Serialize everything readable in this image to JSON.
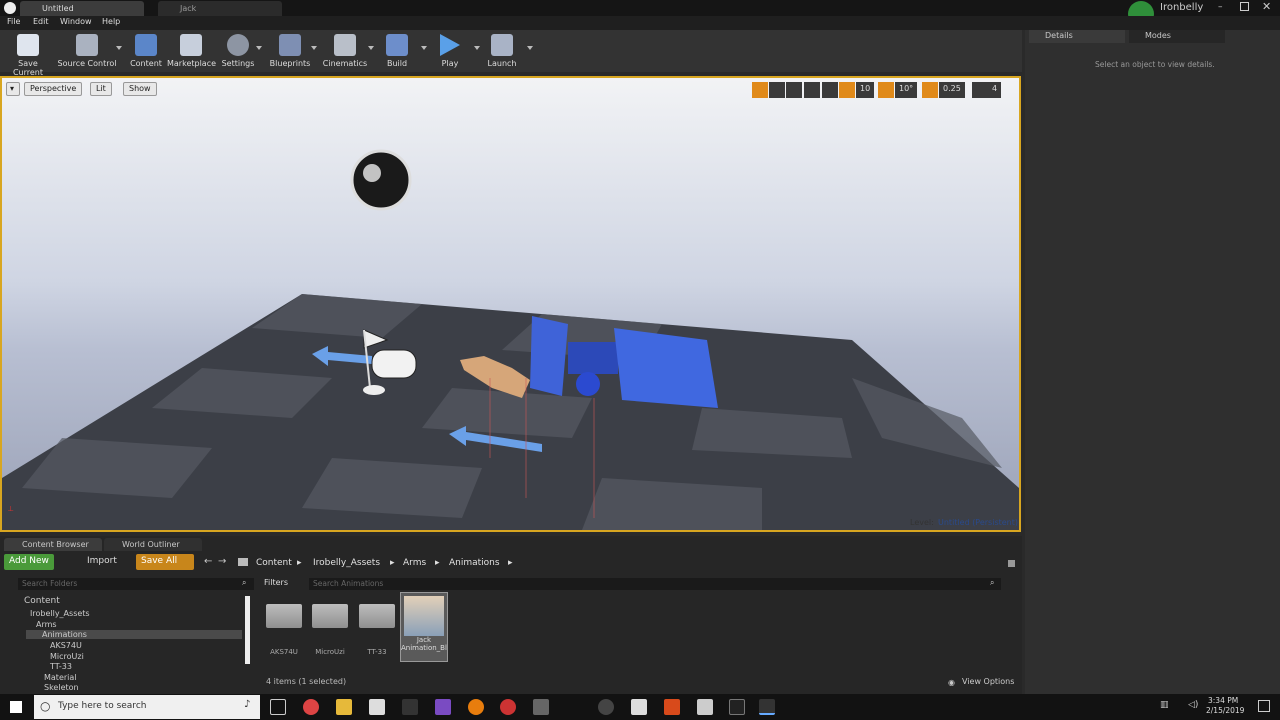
{
  "title_tabs": [
    "Untitled",
    "Jack"
  ],
  "user": "Ironbelly",
  "menus": [
    "File",
    "Edit",
    "Window",
    "Help"
  ],
  "toolbar": [
    "Save Current",
    "Source Control",
    "Content",
    "Marketplace",
    "Settings",
    "Blueprints",
    "Cinematics",
    "Build",
    "Play",
    "Launch"
  ],
  "viewport": {
    "perspective": "Perspective",
    "lit": "Lit",
    "show": "Show",
    "grid": "10",
    "rot": "10°",
    "scale": "0.25",
    "cam": "4",
    "level_label": "Level:",
    "level_name": "Untitled (Persistent)"
  },
  "details": {
    "tab": "Details",
    "modes": "Modes",
    "hint": "Select an object to view details."
  },
  "cb": {
    "tab1": "Content Browser",
    "tab2": "World Outliner",
    "add_new": "Add New",
    "import": "Import",
    "save_all": "Save All",
    "crumbs": [
      "Content",
      "Irobelly_Assets",
      "Arms",
      "Animations"
    ],
    "search_folders": "Search Folders",
    "filters": "Filters",
    "search_anim": "Search Animations",
    "tree": [
      "Content",
      "Irobelly_Assets",
      "Arms",
      "Animations",
      "AKS74U",
      "MicroUzi",
      "TT-33",
      "Material",
      "Skeleton"
    ],
    "assets": [
      "AKS74U",
      "MicroUzi",
      "TT-33",
      "Jack Animation_Blueprint"
    ],
    "count": "4 items (1 selected)",
    "view_options": "View Options"
  },
  "taskbar": {
    "search": "Type here to search",
    "time": "3:34 PM",
    "date": "2/15/2019"
  }
}
